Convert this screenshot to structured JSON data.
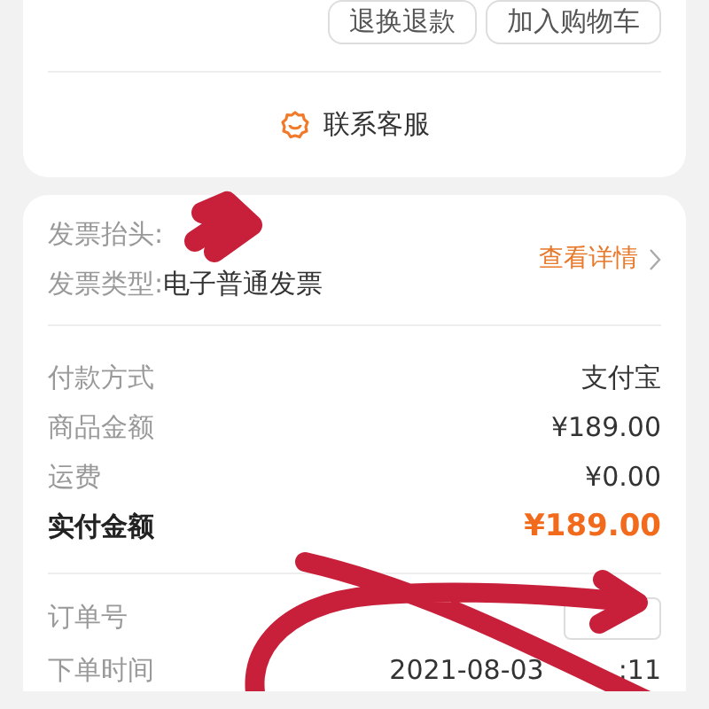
{
  "order_actions": [
    "退换退款",
    "加入购物车"
  ],
  "service_link": "联系客服",
  "invoice": {
    "title_label": "发票抬头:",
    "type_label": "发票类型:",
    "type_value": "电子普通发票",
    "details_link": "查看详情"
  },
  "payment": [
    {
      "label": "付款方式",
      "value": "支付宝",
      "kind": "plain"
    },
    {
      "label": "商品金额",
      "value": "¥189.00",
      "kind": "plain"
    },
    {
      "label": "运费",
      "value": "¥0.00",
      "kind": "plain"
    },
    {
      "label": "实付金额",
      "value": "¥189.00",
      "kind": "total"
    }
  ],
  "order_info": {
    "number_label": "订单号",
    "time_label": "下单时间",
    "time_value": [
      "2021-08-03",
      ":11"
    ]
  }
}
